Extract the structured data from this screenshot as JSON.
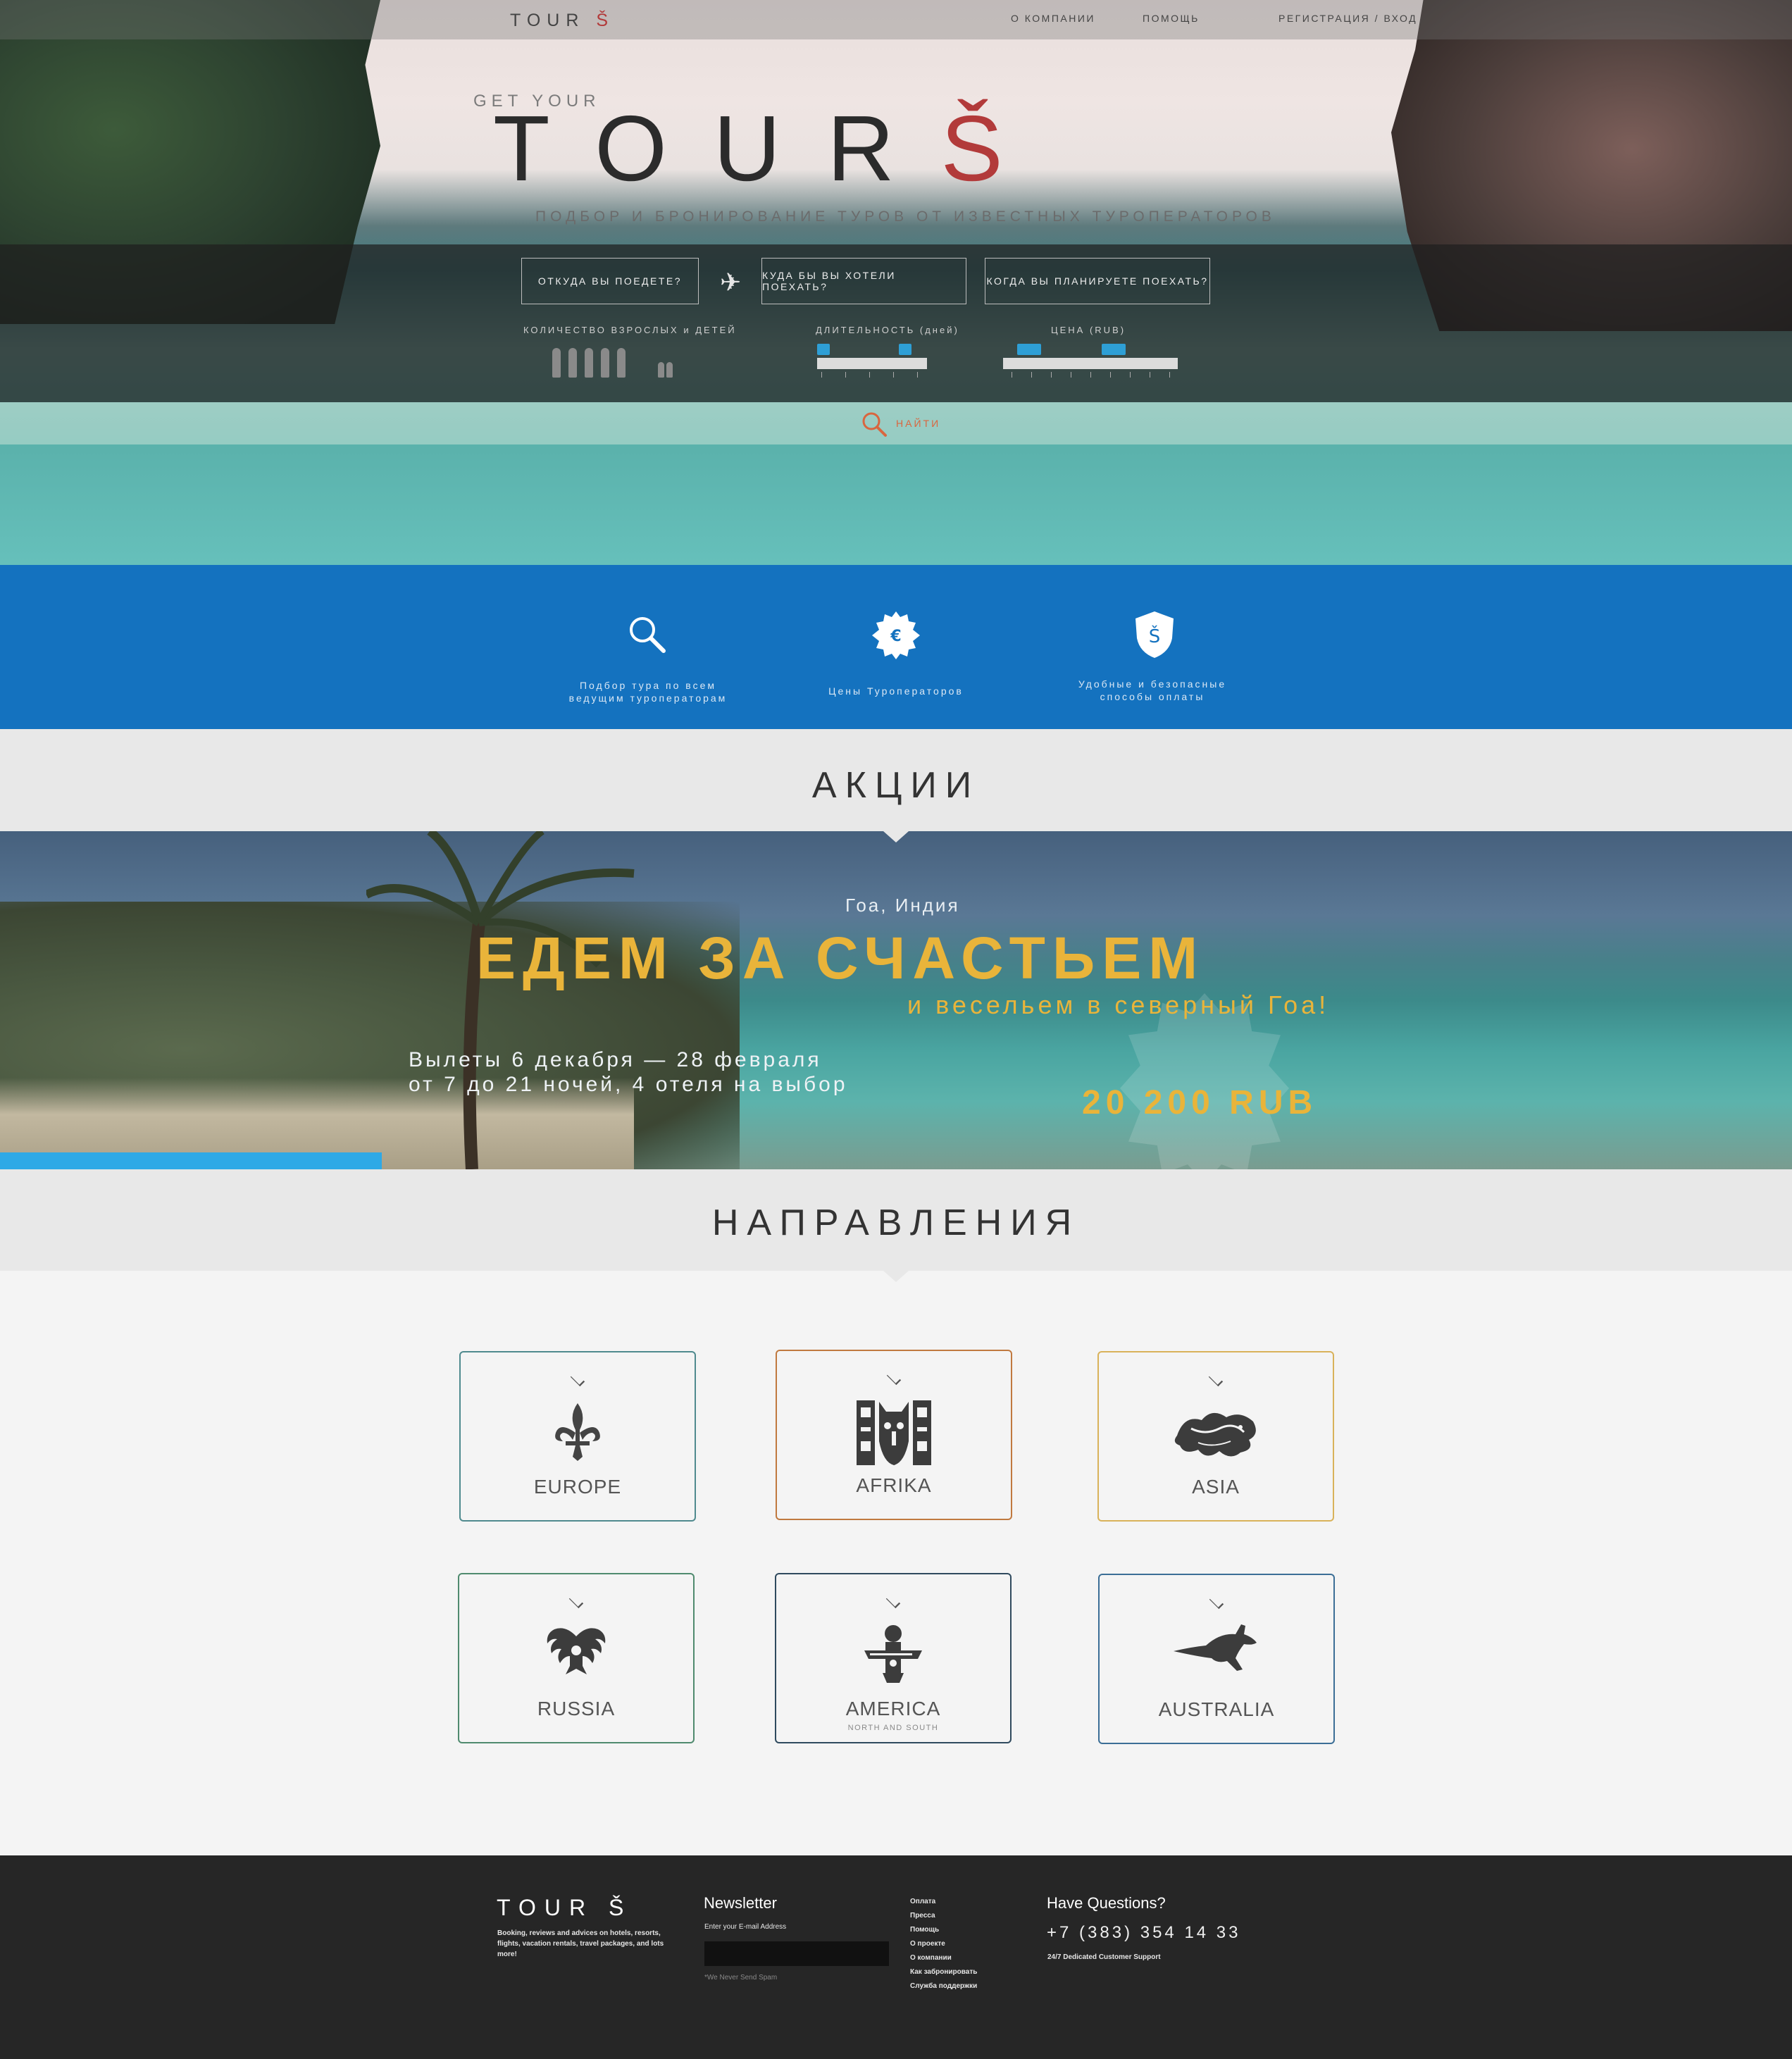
{
  "brand": {
    "name": "TOUR",
    "mark": "Š"
  },
  "nav": {
    "about": "О КОМПАНИИ",
    "help": "ПОМОЩЬ",
    "register": "РЕГИСТРАЦИЯ / ВХОД"
  },
  "hero": {
    "kicker": "GET YOUR",
    "title": "TOUR",
    "title_mark": "Š",
    "subtitle": "ПОДБОР И БРОНИРОВАНИЕ ТУРОВ ОТ ИЗВЕСТНЫХ ТУРОПЕРАТОРОВ"
  },
  "search": {
    "from_label": "ОТКУДА ВЫ ПОЕДЕТЕ?",
    "to_label": "КУДА БЫ ВЫ ХОТЕЛИ ПОЕХАТЬ?",
    "when_label": "КОГДА ВЫ ПЛАНИРУЕТЕ ПОЕХАТЬ?",
    "people_label": "КОЛИЧЕСТВО ВЗРОСЛЫХ и ДЕТЕЙ",
    "duration_label": "ДЛИТЕЛЬНОСТЬ (дней)",
    "price_label": "ЦЕНА (RUB)",
    "find_label": "НАЙТИ",
    "adults": 5,
    "children": 2
  },
  "features": [
    {
      "icon": "search-icon",
      "label_line1": "Подбор тура по всем",
      "label_line2": "ведущим туроператорам"
    },
    {
      "icon": "euro-badge-icon",
      "label_line1": "Цены Туроператоров",
      "label_line2": ""
    },
    {
      "icon": "shield-icon",
      "label_line1": "Удобные и безопасные",
      "label_line2": "способы оплаты"
    }
  ],
  "promos": {
    "heading": "АКЦИИ",
    "location": "Гоа, Индия",
    "headline": "ЕДЕМ ЗА СЧАСТЬЕМ",
    "subheadline": "и весельем в северный Гоа!",
    "dates": "Вылеты 6 декабря — 28 февраля",
    "details": "от 7 до 21 ночей, 4 отеля на выбор",
    "price": "20 200 RUB"
  },
  "directions": {
    "heading": "НАПРАВЛЕНИЯ",
    "items": [
      {
        "label": "EUROPE",
        "sub": "",
        "icon": "fleur-de-lis-icon",
        "color": "#4f8a8e"
      },
      {
        "label": "AFRIKA",
        "sub": "",
        "icon": "african-mask-icon",
        "color": "#c0793f"
      },
      {
        "label": "ASIA",
        "sub": "",
        "icon": "dragon-icon",
        "color": "#d9b25a"
      },
      {
        "label": "RUSSIA",
        "sub": "",
        "icon": "double-eagle-icon",
        "color": "#4f8a6e"
      },
      {
        "label": "AMERICA",
        "sub": "NORTH AND SOUTH",
        "icon": "thunderbird-icon",
        "color": "#2f4a5e"
      },
      {
        "label": "AUSTRALIA",
        "sub": "",
        "icon": "kangaroo-icon",
        "color": "#3b6e96"
      }
    ]
  },
  "footer": {
    "brand": "TOUR",
    "brand_mark": "Š",
    "about": "Booking, reviews and advices on hotels, resorts, flights, vacation rentals, travel packages, and lots more!",
    "newsletter_title": "Newsletter",
    "newsletter_label": "Enter your E-mail Address",
    "newsletter_note": "*We Never Send Spam",
    "links": [
      "Оплата",
      "Пресса",
      "Помощь",
      "О проекте",
      "О компании",
      "Как забронировать",
      "Служба поддержки"
    ],
    "questions_title": "Have Questions?",
    "phone": "+7 (383) 354 14 33",
    "support": "24/7 Dedicated Customer Support"
  },
  "colors": {
    "accent_blue": "#1472bf",
    "brand_red": "#b23a3a",
    "promo_gold": "#e9b43a",
    "slider_blue": "#2e9fd6"
  }
}
